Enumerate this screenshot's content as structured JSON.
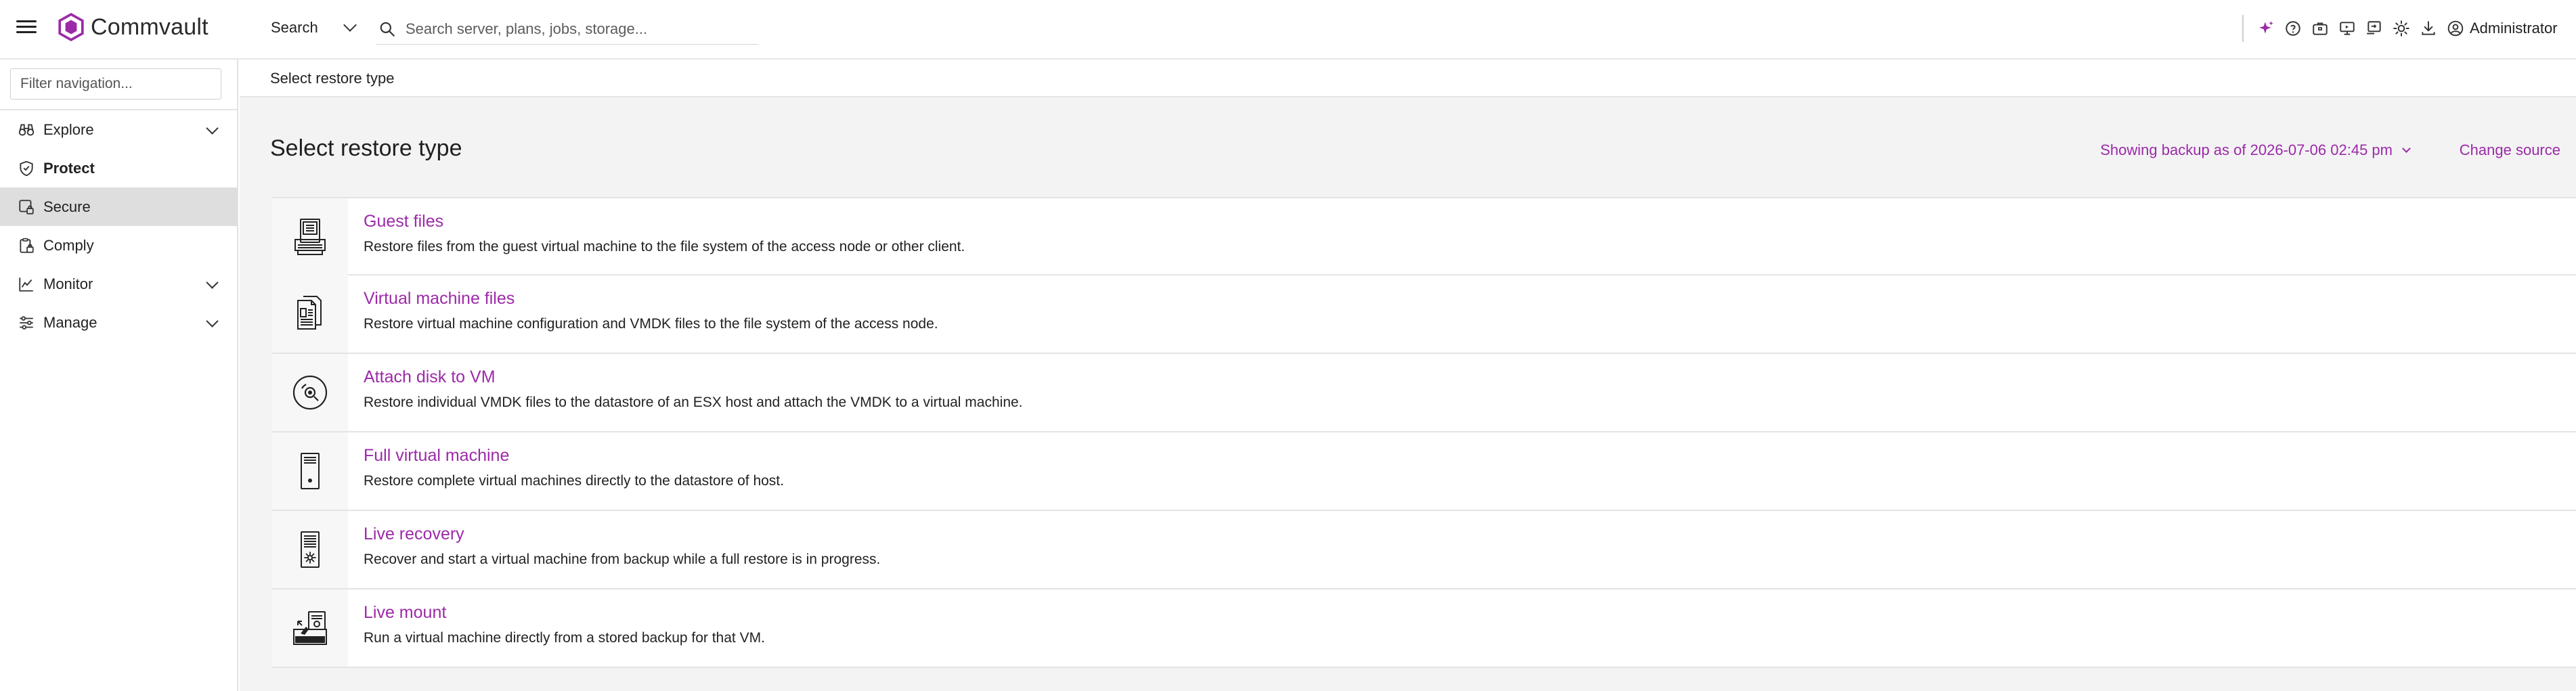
{
  "header": {
    "brand": "Commvault",
    "search_scope": "Search",
    "search_placeholder": "Search server, plans, jobs, storage...",
    "user": "Administrator",
    "icons": [
      "sparkle-icon",
      "help-icon",
      "briefcase-icon",
      "monitor-icon",
      "screen-mirror-icon",
      "sun-icon",
      "download-icon",
      "user-icon"
    ]
  },
  "sidebar": {
    "filter_placeholder": "Filter navigation...",
    "items": [
      {
        "label": "Explore",
        "icon": "binoculars-icon",
        "expandable": true
      },
      {
        "label": "Protect",
        "icon": "shield-check-icon",
        "expandable": false
      },
      {
        "label": "Secure",
        "icon": "lock-screen-icon",
        "expandable": false
      },
      {
        "label": "Comply",
        "icon": "clipboard-lock-icon",
        "expandable": false
      },
      {
        "label": "Monitor",
        "icon": "line-chart-icon",
        "expandable": true
      },
      {
        "label": "Manage",
        "icon": "sliders-icon",
        "expandable": true
      }
    ]
  },
  "main": {
    "breadcrumb": "Select restore type",
    "title": "Select restore type",
    "backup_info": "Showing backup as of 2026-07-06 02:45 pm",
    "change_source": "Change source",
    "options": [
      {
        "title": "Guest files",
        "description": "Restore files from the guest virtual machine to the file system of the access node or other client.",
        "icon": "guest-files-icon"
      },
      {
        "title": "Virtual machine files",
        "description": "Restore virtual machine configuration and VMDK files to the file system of the access node.",
        "icon": "vm-files-icon"
      },
      {
        "title": "Attach disk to VM",
        "description": "Restore individual VMDK files to the datastore of an ESX host and attach the VMDK to a virtual machine.",
        "icon": "disk-icon"
      },
      {
        "title": "Full virtual machine",
        "description": "Restore complete virtual machines directly to the datastore of host.",
        "icon": "server-icon"
      },
      {
        "title": "Live recovery",
        "description": "Recover and start a virtual machine from backup while a full restore is in progress.",
        "icon": "live-recovery-icon"
      },
      {
        "title": "Live mount",
        "description": "Run a virtual machine directly from a stored backup for that VM.",
        "icon": "live-mount-icon"
      }
    ]
  },
  "colors": {
    "accent": "#9c2aa8",
    "sidebar_active": "#dedede",
    "main_bg": "#f3f3f4"
  }
}
